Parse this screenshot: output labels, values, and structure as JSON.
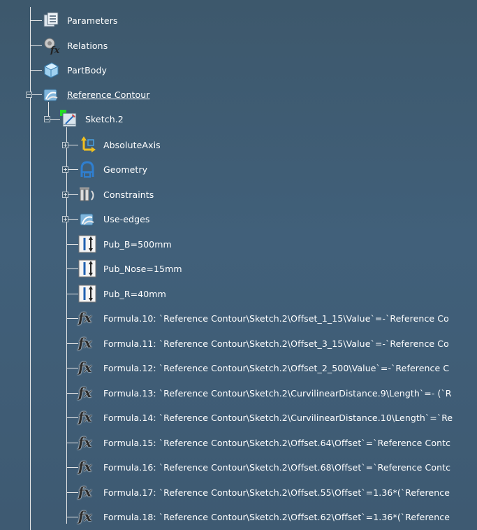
{
  "tree": {
    "root_items": [
      {
        "label": "Parameters",
        "icon": "parameters-icon"
      },
      {
        "label": "Relations",
        "icon": "relations-icon"
      },
      {
        "label": "PartBody",
        "icon": "partbody-icon"
      },
      {
        "label": "Reference Contour",
        "icon": "geometrical-set-icon"
      }
    ],
    "sketch": {
      "label": "Sketch.2",
      "icon": "sketch-icon"
    },
    "sketch_children": [
      {
        "label": "AbsoluteAxis",
        "icon": "axis-icon"
      },
      {
        "label": "Geometry",
        "icon": "geometry-icon"
      },
      {
        "label": "Constraints",
        "icon": "constraints-icon"
      },
      {
        "label": "Use-edges",
        "icon": "use-edges-icon"
      },
      {
        "label": "Pub_B=500mm",
        "icon": "publication-icon"
      },
      {
        "label": "Pub_Nose=15mm",
        "icon": "publication-icon"
      },
      {
        "label": "Pub_R=40mm",
        "icon": "publication-icon"
      },
      {
        "label": "Formula.10: `Reference Contour\\Sketch.2\\Offset_1_15\\Value`=-`Reference Co",
        "icon": "formula-icon"
      },
      {
        "label": "Formula.11: `Reference Contour\\Sketch.2\\Offset_3_15\\Value`=-`Reference Co",
        "icon": "formula-icon"
      },
      {
        "label": "Formula.12: `Reference Contour\\Sketch.2\\Offset_2_500\\Value`=-`Reference C",
        "icon": "formula-icon"
      },
      {
        "label": "Formula.13: `Reference Contour\\Sketch.2\\CurvilinearDistance.9\\Length`=- (`R",
        "icon": "formula-icon"
      },
      {
        "label": "Formula.14: `Reference Contour\\Sketch.2\\CurvilinearDistance.10\\Length`=`Re",
        "icon": "formula-icon"
      },
      {
        "label": "Formula.15: `Reference Contour\\Sketch.2\\Offset.64\\Offset`=`Reference Contc",
        "icon": "formula-icon"
      },
      {
        "label": "Formula.16: `Reference Contour\\Sketch.2\\Offset.68\\Offset`=`Reference Contc",
        "icon": "formula-icon"
      },
      {
        "label": "Formula.17: `Reference Contour\\Sketch.2\\Offset.55\\Offset`=1.36*(`Reference",
        "icon": "formula-icon"
      },
      {
        "label": "Formula.18: `Reference Contour\\Sketch.2\\Offset.62\\Offset`=1.36*(`Reference",
        "icon": "formula-icon"
      }
    ],
    "formula_symbol": "fx"
  },
  "colors": {
    "background": "#3f5a6e",
    "tree_line": "#e8e8e8",
    "text": "#ffffff",
    "sketch_green": "#22dd22"
  }
}
